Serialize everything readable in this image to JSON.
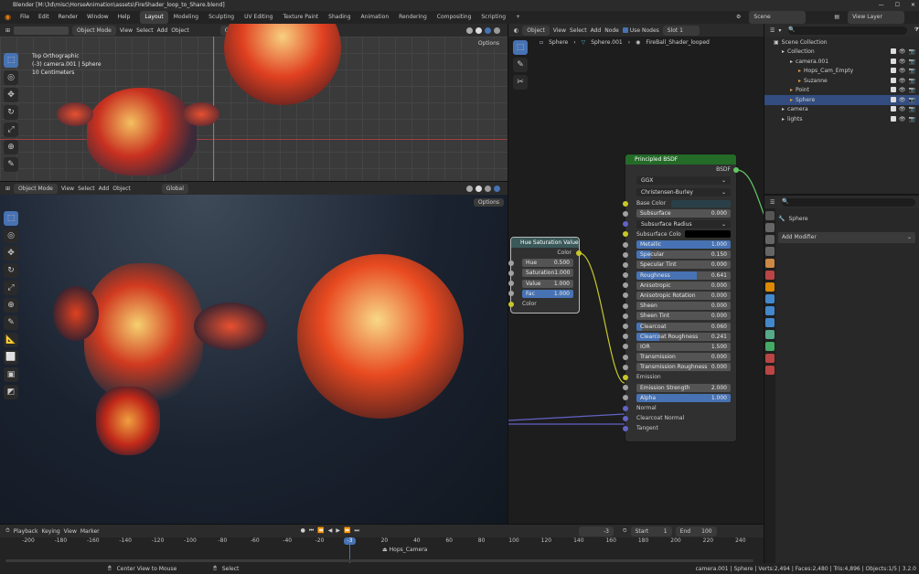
{
  "title": "Blender [M:\\3d\\misc\\HorseAnimation\\assets\\FireShader_loop_to_Share.blend]",
  "menu": [
    "File",
    "Edit",
    "Render",
    "Window",
    "Help"
  ],
  "workspaces": [
    "Layout",
    "Modeling",
    "Sculpting",
    "UV Editing",
    "Texture Paint",
    "Shading",
    "Animation",
    "Rendering",
    "Compositing",
    "Scripting"
  ],
  "scene": "Scene",
  "view_layer": "View Layer",
  "vp": {
    "mode": "Object Mode",
    "view": "View",
    "select": "Select",
    "add": "Add",
    "object": "Object",
    "orient": "Global",
    "options": "Options"
  },
  "vp_top": {
    "l1": "Top Orthographic",
    "l2": "(-3) camera.001 | Sphere",
    "l3": "10 Centimeters"
  },
  "ne": {
    "type": "Object",
    "view": "View",
    "select": "Select",
    "add": "Add",
    "node": "Node",
    "use_nodes": "Use Nodes",
    "slot": "Slot 1",
    "bc1": "Sphere",
    "bc2": "Sphere.001",
    "bc3": "FireBall_Shader_looped"
  },
  "hsv": {
    "title": "Hue Saturation Value",
    "out": "Color",
    "rows": [
      {
        "l": "Hue",
        "v": "0.500"
      },
      {
        "l": "Saturation",
        "v": "1.000"
      },
      {
        "l": "Value",
        "v": "1.000"
      },
      {
        "l": "Fac",
        "v": "1.000"
      }
    ],
    "in": "Color"
  },
  "bsdf": {
    "title": "Principled BSDF",
    "out": "BSDF",
    "dist": "GGX",
    "sss": "Christensen-Burley",
    "base": "Base Color",
    "subsurface": {
      "l": "Subsurface",
      "v": "0.000"
    },
    "ssr": "Subsurface Radius",
    "ssc": "Subsurface Colo",
    "rows": [
      {
        "l": "Metallic",
        "v": "1.000",
        "f": 1
      },
      {
        "l": "Specular",
        "v": "0.150",
        "f": 0.15
      },
      {
        "l": "Specular Tint",
        "v": "0.000",
        "f": 0
      },
      {
        "l": "Roughness",
        "v": "0.641",
        "f": 0.641
      },
      {
        "l": "Anisotropic",
        "v": "0.000",
        "f": 0
      },
      {
        "l": "Anisotropic Rotation",
        "v": "0.000",
        "f": 0
      },
      {
        "l": "Sheen",
        "v": "0.000",
        "f": 0
      },
      {
        "l": "Sheen Tint",
        "v": "0.000",
        "f": 0
      },
      {
        "l": "Clearcoat",
        "v": "0.060",
        "f": 0.06
      },
      {
        "l": "Clearcoat Roughness",
        "v": "0.241",
        "f": 0.241
      },
      {
        "l": "IOR",
        "v": "1.500",
        "f": 0
      },
      {
        "l": "Transmission",
        "v": "0.000",
        "f": 0
      },
      {
        "l": "Transmission Roughness",
        "v": "0.000",
        "f": 0
      }
    ],
    "emission": "Emission",
    "emstr": {
      "l": "Emission Strength",
      "v": "2.000"
    },
    "alpha": {
      "l": "Alpha",
      "v": "1.000"
    },
    "normal": "Normal",
    "ccn": "Clearcoat Normal",
    "tangent": "Tangent"
  },
  "outliner": {
    "root": "Scene Collection",
    "items": [
      {
        "n": "Collection",
        "d": 1,
        "c": "#ccc"
      },
      {
        "n": "camera.001",
        "d": 2,
        "c": "#ccc"
      },
      {
        "n": "Hops_Cam_Empty",
        "d": 3,
        "c": "#e0a050"
      },
      {
        "n": "Suzanne",
        "d": 3,
        "c": "#e0a050"
      },
      {
        "n": "Point",
        "d": 2,
        "c": "#e0a050"
      },
      {
        "n": "Sphere",
        "d": 2,
        "c": "#e0a050",
        "sel": true
      },
      {
        "n": "camera",
        "d": 1,
        "c": "#ccc"
      },
      {
        "n": "lights",
        "d": 1,
        "c": "#ccc"
      }
    ]
  },
  "props": {
    "object": "Sphere",
    "add_modifier": "Add Modifier"
  },
  "timeline": {
    "menus": [
      "Playback",
      "Keying",
      "View",
      "Marker"
    ],
    "current": "-3",
    "start_l": "Start",
    "start": "1",
    "end_l": "End",
    "end": "100",
    "marker": "Hops_Camera",
    "ticks": [
      "-200",
      "-180",
      "-160",
      "-140",
      "-120",
      "-100",
      "-80",
      "-60",
      "-40",
      "-20",
      "0",
      "20",
      "40",
      "60",
      "80",
      "100",
      "120",
      "140",
      "160",
      "180",
      "200",
      "220",
      "240"
    ],
    "playhead": "-3"
  },
  "status": {
    "l1": "Center View to Mouse",
    "l2": "Select",
    "right": "camera.001 | Sphere | Verts:2,494 | Faces:2,480 | Tris:4,896 | Objects:1/5 | 3.2.0"
  }
}
